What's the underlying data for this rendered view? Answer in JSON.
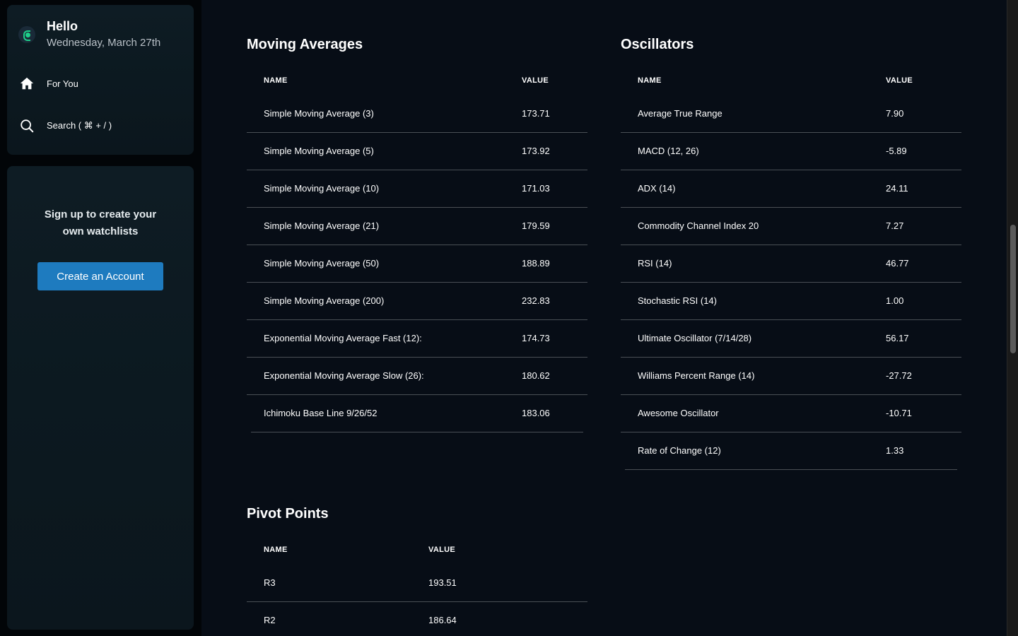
{
  "sidebar": {
    "hello": "Hello",
    "date": "Wednesday, March 27th",
    "nav": [
      {
        "label": "For You",
        "icon": "home-icon"
      },
      {
        "label": "Search ( ⌘ + / )",
        "icon": "search-icon"
      }
    ],
    "signup_line1": "Sign up to create your",
    "signup_line2": "own watchlists",
    "create_button": "Create an Account"
  },
  "moving_averages": {
    "title": "Moving Averages",
    "col_name": "NAME",
    "col_value": "VALUE",
    "rows": [
      {
        "name": "Simple Moving Average (3)",
        "value": "173.71"
      },
      {
        "name": "Simple Moving Average (5)",
        "value": "173.92"
      },
      {
        "name": "Simple Moving Average (10)",
        "value": "171.03"
      },
      {
        "name": "Simple Moving Average (21)",
        "value": "179.59"
      },
      {
        "name": "Simple Moving Average (50)",
        "value": "188.89"
      },
      {
        "name": "Simple Moving Average (200)",
        "value": "232.83"
      },
      {
        "name": "Exponential Moving Average Fast (12):",
        "value": "174.73"
      },
      {
        "name": "Exponential Moving Average Slow (26):",
        "value": "180.62"
      },
      {
        "name": "Ichimoku Base Line 9/26/52",
        "value": "183.06"
      }
    ]
  },
  "oscillators": {
    "title": "Oscillators",
    "col_name": "NAME",
    "col_value": "VALUE",
    "rows": [
      {
        "name": "Average True Range",
        "value": "7.90"
      },
      {
        "name": "MACD (12, 26)",
        "value": "-5.89"
      },
      {
        "name": "ADX (14)",
        "value": "24.11"
      },
      {
        "name": "Commodity Channel Index 20",
        "value": "7.27"
      },
      {
        "name": "RSI (14)",
        "value": "46.77"
      },
      {
        "name": "Stochastic RSI (14)",
        "value": "1.00"
      },
      {
        "name": "Ultimate Oscillator (7/14/28)",
        "value": "56.17"
      },
      {
        "name": "Williams Percent Range (14)",
        "value": "-27.72"
      },
      {
        "name": "Awesome Oscillator",
        "value": "-10.71"
      },
      {
        "name": "Rate of Change (12)",
        "value": "1.33"
      }
    ]
  },
  "pivot_points": {
    "title": "Pivot Points",
    "col_name": "NAME",
    "col_value": "VALUE",
    "rows": [
      {
        "name": "R3",
        "value": "193.51"
      },
      {
        "name": "R2",
        "value": "186.64"
      }
    ]
  },
  "colors": {
    "accent": "#1e7bbf",
    "logo_green": "#1ecf8a",
    "main_bg": "#070d16",
    "panel_bg": "#0e1c24"
  }
}
